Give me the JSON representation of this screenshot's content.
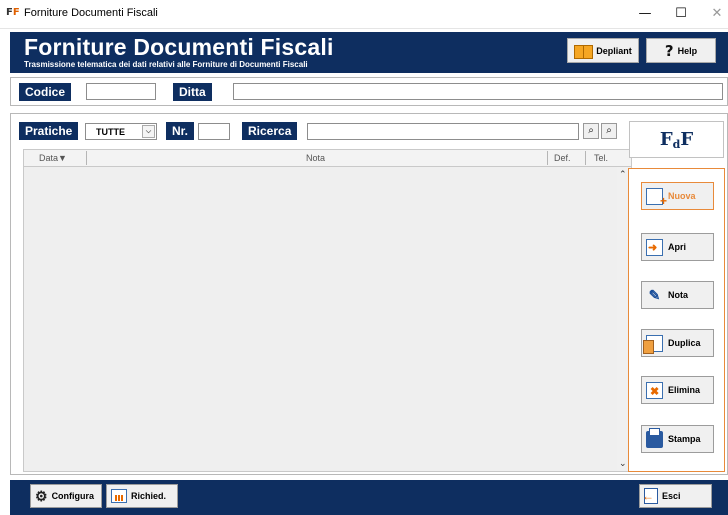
{
  "window": {
    "title": "Forniture Documenti Fiscali",
    "icon_text": "F",
    "icon_text2": "F",
    "minimize_glyph": "—",
    "maximize_glyph": "☐",
    "close_glyph": "✕"
  },
  "header": {
    "title": "Forniture Documenti Fiscali",
    "subtitle": "Trasmissione telematica dei dati relativi alle Forniture di Documenti Fiscali",
    "depliant_label": "Depliant",
    "help_label": "Help",
    "help_glyph": "?",
    "bg_color": "#0e2e60"
  },
  "filters": {
    "codice_label": "Codice",
    "codice_value": "",
    "ditta_label": "Ditta",
    "ditta_value": ""
  },
  "search": {
    "pratiche_label": "Pratiche",
    "pratiche_selected": "TUTTE",
    "nr_label": "Nr.",
    "nr_value": "",
    "ricerca_label": "Ricerca",
    "ricerca_value": ""
  },
  "grid": {
    "columns": {
      "data": "Data",
      "nota": "Nota",
      "def": "Def.",
      "tel": "Tel."
    },
    "sort_glyph": "▼",
    "rows": []
  },
  "logo": {
    "main": "F",
    "sub": "d",
    "end": "F"
  },
  "actions": {
    "nuova": "Nuova",
    "apri": "Apri",
    "nota": "Nota",
    "duplica": "Duplica",
    "elimina": "Elimina",
    "stampa": "Stampa",
    "accent_color": "#e88a3a"
  },
  "footer": {
    "configura": "Configura",
    "richied": "Richied.",
    "esci": "Esci"
  }
}
